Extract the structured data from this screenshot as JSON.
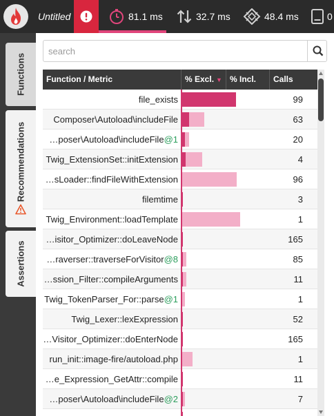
{
  "app": {
    "title": "Untitled",
    "icons": {
      "logo": "flame-icon",
      "alert": "exclamation-icon"
    }
  },
  "metrics": {
    "wall_time": {
      "value": "81.1 ms",
      "icon": "stopwatch-icon"
    },
    "io_time": {
      "value": "32.7 ms",
      "icon": "io-arrows-icon"
    },
    "cpu_time": {
      "value": "48.4 ms",
      "icon": "cpu-chip-icon"
    },
    "memory": {
      "value": "0",
      "icon": "memory-icon"
    }
  },
  "sidebar": {
    "tabs": [
      {
        "label": "Functions",
        "active": true
      },
      {
        "label": "Recommendations",
        "icon": "warning-triangle-icon"
      },
      {
        "label": "Assertions"
      }
    ]
  },
  "search": {
    "placeholder": "search",
    "value": "",
    "icon": "magnifier-icon"
  },
  "table": {
    "columns": [
      "Function / Metric",
      "% Excl.",
      "% Incl.",
      "Calls"
    ],
    "sort_indicator": "▼",
    "rows": [
      {
        "name": "file_exists",
        "suffix": "",
        "excl": 0.61,
        "incl": 0.61,
        "calls": "99"
      },
      {
        "name": "Composer\\Autoload\\includeFile",
        "suffix": "",
        "excl": 0.08,
        "incl": 0.25,
        "calls": "63"
      },
      {
        "name": "…poser\\Autoload\\includeFile",
        "suffix": "@1",
        "excl": 0.03,
        "incl": 0.08,
        "calls": "20"
      },
      {
        "name": "Twig_ExtensionSet::initExtension",
        "suffix": "",
        "excl": 0.04,
        "incl": 0.23,
        "calls": "4"
      },
      {
        "name": "…sLoader::findFileWithExtension",
        "suffix": "",
        "excl": 0.0,
        "incl": 0.62,
        "calls": "96"
      },
      {
        "name": "filemtime",
        "suffix": "",
        "excl": 0.01,
        "incl": 0.01,
        "calls": "3"
      },
      {
        "name": "Twig_Environment::loadTemplate",
        "suffix": "",
        "excl": 0.0,
        "incl": 0.66,
        "calls": "1"
      },
      {
        "name": "…isitor_Optimizer::doLeaveNode",
        "suffix": "",
        "excl": 0.01,
        "incl": 0.01,
        "calls": "165"
      },
      {
        "name": "…raverser::traverseForVisitor",
        "suffix": "@8",
        "excl": 0.01,
        "incl": 0.05,
        "calls": "85"
      },
      {
        "name": "…ssion_Filter::compileArguments",
        "suffix": "",
        "excl": 0.01,
        "incl": 0.05,
        "calls": "11"
      },
      {
        "name": "Twig_TokenParser_For::parse",
        "suffix": "@1",
        "excl": 0.0,
        "incl": 0.03,
        "calls": "1"
      },
      {
        "name": "Twig_Lexer::lexExpression",
        "suffix": "",
        "excl": 0.01,
        "incl": 0.01,
        "calls": "52"
      },
      {
        "name": "…Visitor_Optimizer::doEnterNode",
        "suffix": "",
        "excl": 0.01,
        "incl": 0.01,
        "calls": "165"
      },
      {
        "name": "run_init::image-fire/autoload.php",
        "suffix": "",
        "excl": 0.0,
        "incl": 0.12,
        "calls": "1"
      },
      {
        "name": "…e_Expression_GetAttr::compile",
        "suffix": "",
        "excl": 0.01,
        "incl": 0.01,
        "calls": "11"
      },
      {
        "name": "…poser\\Autoload\\includeFile",
        "suffix": "@2",
        "excl": 0.01,
        "incl": 0.03,
        "calls": "7"
      },
      {
        "name": "",
        "suffix": "",
        "excl": 0.01,
        "incl": 0.01,
        "calls": ""
      }
    ]
  },
  "colors": {
    "accent": "#d1366e",
    "accent_light": "#f3afc8",
    "alert": "#d8263e",
    "topbar": "#2b2b2b",
    "suffix_green": "#2a9d5b"
  }
}
